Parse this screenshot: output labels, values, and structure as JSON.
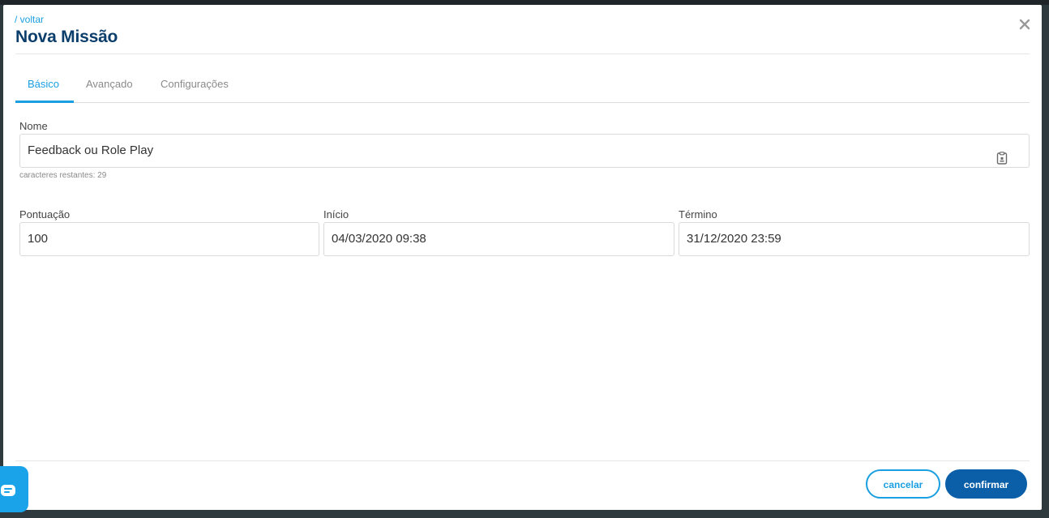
{
  "modal": {
    "back_link": "/ voltar",
    "title": "Nova Missão"
  },
  "tabs": [
    {
      "label": "Básico",
      "active": true
    },
    {
      "label": "Avançado",
      "active": false
    },
    {
      "label": "Configurações",
      "active": false
    }
  ],
  "form": {
    "nome": {
      "label": "Nome",
      "value": "Feedback ou Role Play",
      "counter": "caracteres restantes: 29"
    },
    "pontuacao": {
      "label": "Pontuação",
      "value": "100"
    },
    "inicio": {
      "label": "Início",
      "value": "04/03/2020 09:38"
    },
    "termino": {
      "label": "Término",
      "value": "31/12/2020 23:59"
    }
  },
  "footer": {
    "cancel_label": "cancelar",
    "confirm_label": "confirmar"
  },
  "icons": {
    "close": "close-icon",
    "clipboard": "clipboard-icon",
    "chat": "chat-icon"
  },
  "colors": {
    "accent": "#1a9fe0",
    "primary_button": "#0a5fa8",
    "title": "#0c3e6b"
  }
}
